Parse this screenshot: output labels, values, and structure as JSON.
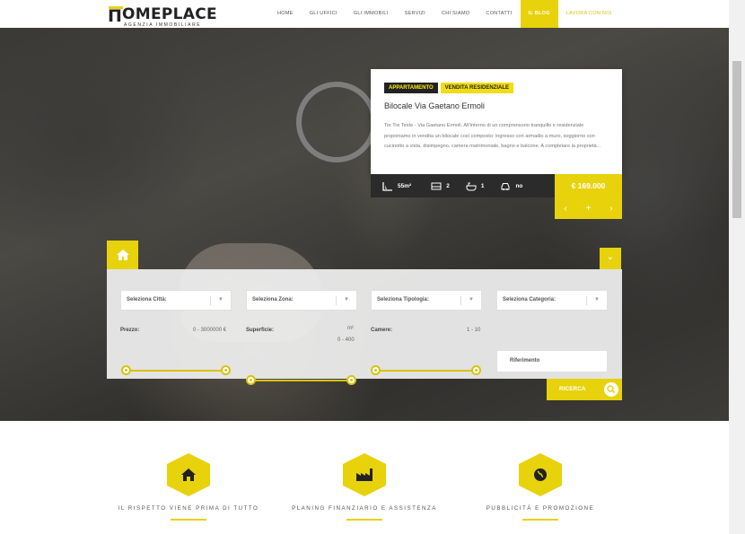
{
  "brand": {
    "logo_main": "OMEPLACE",
    "logo_sub": "AGENZIA IMMOBILIARE"
  },
  "nav": {
    "items": [
      {
        "label": "HOME"
      },
      {
        "label": "GLI UFFICI"
      },
      {
        "label": "GLI IMMOBILI"
      },
      {
        "label": "SERVIZI"
      },
      {
        "label": "CHI SIAMO"
      },
      {
        "label": "CONTATTI"
      },
      {
        "label": "IL BLOG"
      },
      {
        "label": "LAVORA CON NOI"
      }
    ],
    "active": "IL BLOG"
  },
  "listing": {
    "tags": [
      "APPARTAMENTO",
      "VENDITA RESIDENZIALE"
    ],
    "title": "Bilocale Via Gaetano Ermoli",
    "description": "Tor Tre Teste - Via Gaetano Ermoli. All'interno di un comprensorio tranquillo e residenziale proponiamo in vendita un bilocale così composto: ingresso con armadio a muro, soggiorno con cucinotto a vista, disimpegno, camera matrimoniale, bagno e balcone. A completare la proprietà...",
    "features": {
      "area": "55m²",
      "rooms": "2",
      "baths": "1",
      "parking": "no"
    },
    "price": "€ 169.000",
    "nav": {
      "prev": "‹",
      "plus": "+",
      "next": "›"
    }
  },
  "search": {
    "city_placeholder": "Seleziona Città:",
    "zone_placeholder": "Seleziona Zona:",
    "type_placeholder": "Seleziona Tipologia:",
    "category_placeholder": "Seleziona Categoria:",
    "price_label": "Prezzo:",
    "price_range": "0 - 3000000 €",
    "area_label": "Superficie:",
    "area_unit": "m²",
    "area_range": "0 - 400",
    "rooms_label": "Camere:",
    "rooms_range": "1 - 10",
    "reference_placeholder": "Riferimento",
    "submit_label": "RICERCA"
  },
  "features_row": [
    {
      "title": "IL RISPETTO VIENE PRIMA DI TUTTO",
      "icon": "home-icon"
    },
    {
      "title": "PLANING FINANZIARIO E ASSISTENZA",
      "icon": "factory-icon"
    },
    {
      "title": "PUBBLICITÀ E PROMOZIONE",
      "icon": "globe-icon"
    }
  ],
  "colors": {
    "accent": "#e7d20c",
    "dark": "#2b2b2b"
  }
}
